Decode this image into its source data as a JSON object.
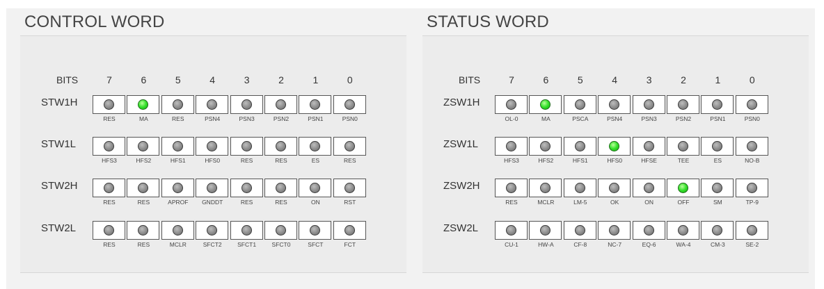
{
  "panels": [
    {
      "title": "CONTROL WORD",
      "bits_label": "BITS",
      "bit_numbers": [
        "7",
        "6",
        "5",
        "4",
        "3",
        "2",
        "1",
        "0"
      ],
      "registers": [
        {
          "name": "STW1H",
          "bits": [
            {
              "label": "RES",
              "on": false
            },
            {
              "label": "MA",
              "on": true
            },
            {
              "label": "RES",
              "on": false
            },
            {
              "label": "PSN4",
              "on": false
            },
            {
              "label": "PSN3",
              "on": false
            },
            {
              "label": "PSN2",
              "on": false
            },
            {
              "label": "PSN1",
              "on": false
            },
            {
              "label": "PSN0",
              "on": false
            }
          ]
        },
        {
          "name": "STW1L",
          "bits": [
            {
              "label": "HFS3",
              "on": false
            },
            {
              "label": "HFS2",
              "on": false
            },
            {
              "label": "HFS1",
              "on": false
            },
            {
              "label": "HFS0",
              "on": false
            },
            {
              "label": "RES",
              "on": false
            },
            {
              "label": "RES",
              "on": false
            },
            {
              "label": "ES",
              "on": false
            },
            {
              "label": "RES",
              "on": false
            }
          ]
        },
        {
          "name": "STW2H",
          "bits": [
            {
              "label": "RES",
              "on": false
            },
            {
              "label": "RES",
              "on": false
            },
            {
              "label": "APROF",
              "on": false
            },
            {
              "label": "GNDDT",
              "on": false
            },
            {
              "label": "RES",
              "on": false
            },
            {
              "label": "RES",
              "on": false
            },
            {
              "label": "ON",
              "on": false
            },
            {
              "label": "RST",
              "on": false
            }
          ]
        },
        {
          "name": "STW2L",
          "bits": [
            {
              "label": "RES",
              "on": false
            },
            {
              "label": "RES",
              "on": false
            },
            {
              "label": "MCLR",
              "on": false
            },
            {
              "label": "SFCT2",
              "on": false
            },
            {
              "label": "SFCT1",
              "on": false
            },
            {
              "label": "SFCT0",
              "on": false
            },
            {
              "label": "SFCT",
              "on": false
            },
            {
              "label": "FCT",
              "on": false
            }
          ]
        }
      ]
    },
    {
      "title": "STATUS WORD",
      "bits_label": "BITS",
      "bit_numbers": [
        "7",
        "6",
        "5",
        "4",
        "3",
        "2",
        "1",
        "0"
      ],
      "registers": [
        {
          "name": "ZSW1H",
          "bits": [
            {
              "label": "OL-0",
              "on": false
            },
            {
              "label": "MA",
              "on": true
            },
            {
              "label": "PSCA",
              "on": false
            },
            {
              "label": "PSN4",
              "on": false
            },
            {
              "label": "PSN3",
              "on": false
            },
            {
              "label": "PSN2",
              "on": false
            },
            {
              "label": "PSN1",
              "on": false
            },
            {
              "label": "PSN0",
              "on": false
            }
          ]
        },
        {
          "name": "ZSW1L",
          "bits": [
            {
              "label": "HFS3",
              "on": false
            },
            {
              "label": "HFS2",
              "on": false
            },
            {
              "label": "HFS1",
              "on": false
            },
            {
              "label": "HFS0",
              "on": true
            },
            {
              "label": "HFSE",
              "on": false
            },
            {
              "label": "TEE",
              "on": false
            },
            {
              "label": "ES",
              "on": false
            },
            {
              "label": "NO-B",
              "on": false
            }
          ]
        },
        {
          "name": "ZSW2H",
          "bits": [
            {
              "label": "RES",
              "on": false
            },
            {
              "label": "MCLR",
              "on": false
            },
            {
              "label": "LM-5",
              "on": false
            },
            {
              "label": "OK",
              "on": false
            },
            {
              "label": "ON",
              "on": false
            },
            {
              "label": "OFF",
              "on": true
            },
            {
              "label": "SM",
              "on": false
            },
            {
              "label": "TP-9",
              "on": false
            }
          ]
        },
        {
          "name": "ZSW2L",
          "bits": [
            {
              "label": "CU-1",
              "on": false
            },
            {
              "label": "HW-A",
              "on": false
            },
            {
              "label": "CF-8",
              "on": false
            },
            {
              "label": "NC-7",
              "on": false
            },
            {
              "label": "EQ-6",
              "on": false
            },
            {
              "label": "WA-4",
              "on": false
            },
            {
              "label": "CM-3",
              "on": false
            },
            {
              "label": "SE-2",
              "on": false
            }
          ]
        }
      ]
    }
  ],
  "colors": {
    "led_on": "#33e02a",
    "led_off": "#8c8c8c",
    "background": "#f2f2f2"
  }
}
